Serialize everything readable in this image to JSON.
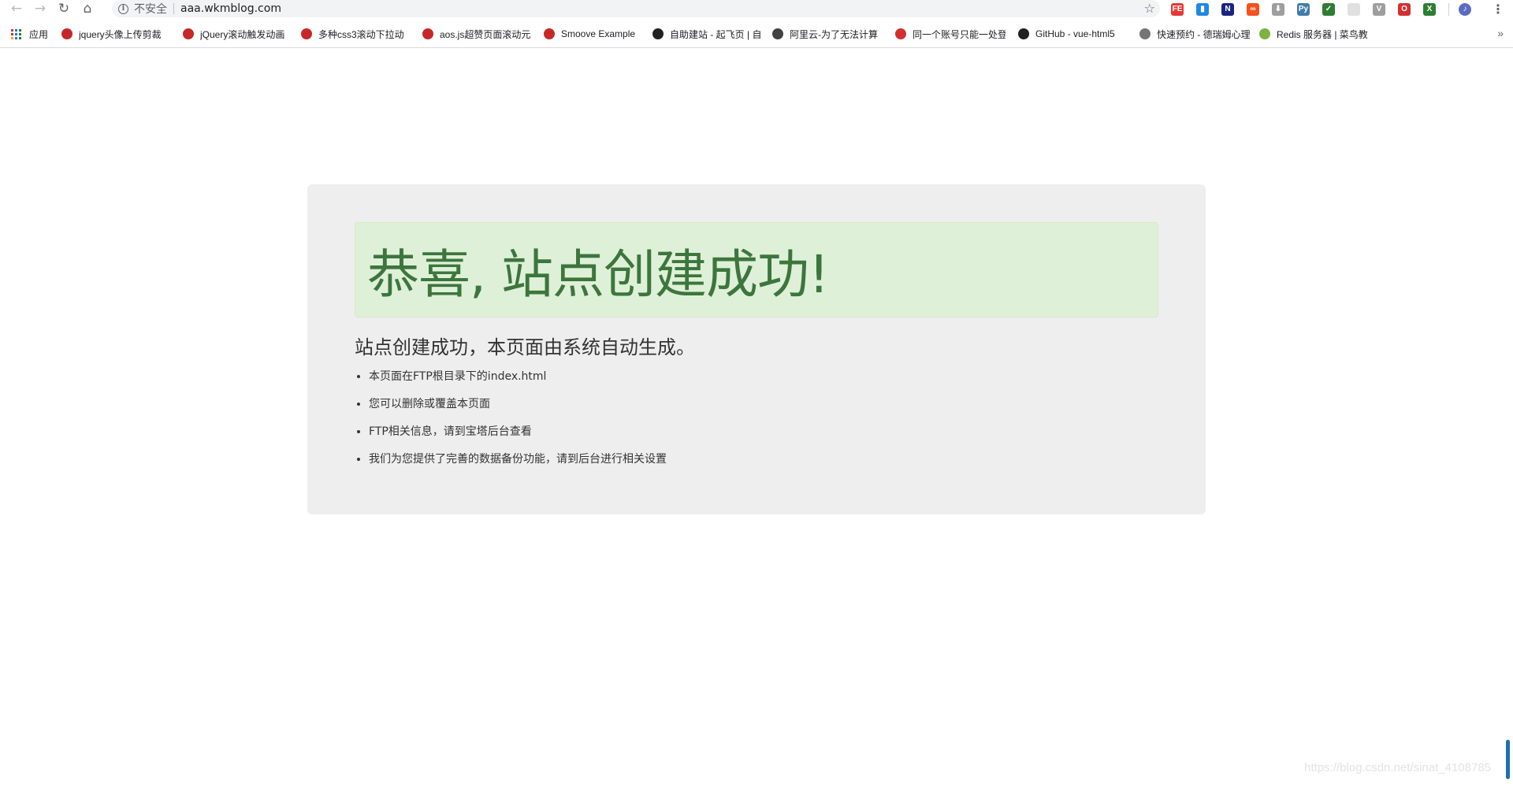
{
  "browser": {
    "nav": {
      "back_icon": "←",
      "forward_icon": "→",
      "reload_icon": "↻",
      "home_icon": "⌂"
    },
    "omnibox": {
      "info_icon": "i",
      "security_label": "不安全",
      "url": "aaa.wkmblog.com",
      "bookmark_star": "☆"
    },
    "extensions": [
      {
        "name": "fe-icon",
        "label": "FE",
        "color": "#e53935"
      },
      {
        "name": "trash-icon",
        "label": "▮",
        "color": "#1e88e5"
      },
      {
        "name": "notion-n-icon",
        "label": "N",
        "color": "#1a237e"
      },
      {
        "name": "infinity-icon",
        "label": "∞",
        "color": "#f4511e"
      },
      {
        "name": "download-icon",
        "label": "⬇",
        "color": "#9e9e9e"
      },
      {
        "name": "python-icon",
        "label": "Py",
        "color": "#3f7cac"
      },
      {
        "name": "shield-icon",
        "label": "✓",
        "color": "#2e7d32"
      },
      {
        "name": "blank-ext-icon",
        "label": "",
        "color": "#e0e0e0"
      },
      {
        "name": "vue-icon",
        "label": "V",
        "color": "#9e9e9e"
      },
      {
        "name": "opera-icon",
        "label": "O",
        "color": "#d32f2f"
      },
      {
        "name": "excel-icon",
        "label": "X",
        "color": "#2e7d32"
      }
    ],
    "profile_icon": "♪",
    "menu_icon": "⋮",
    "bookmarks_bar": {
      "apps_label": "应用",
      "items": [
        {
          "label": "jquery头像上传剪裁",
          "color": "#c62828"
        },
        {
          "label": "jQuery滚动触发动画",
          "color": "#c62828"
        },
        {
          "label": "多种css3滚动下拉动",
          "color": "#c62828"
        },
        {
          "label": "aos.js超赞页面滚动元",
          "color": "#c62828"
        },
        {
          "label": "Smoove Example",
          "color": "#c62828"
        },
        {
          "label": "自助建站 - 起飞页 | 自",
          "color": "#212121"
        },
        {
          "label": "阿里云-为了无法计算",
          "color": "#424242"
        },
        {
          "label": "同一个账号只能一处登",
          "color": "#d32f2f"
        },
        {
          "label": "GitHub - vue-html5",
          "color": "#212121"
        },
        {
          "label": "快速预约 - 德瑞姆心理",
          "color": "#757575"
        },
        {
          "label": "Redis 服务器 | 菜鸟教",
          "color": "#7cb342"
        }
      ],
      "more_icon": "»"
    }
  },
  "page": {
    "heading": "恭喜, 站点创建成功!",
    "lead": "站点创建成功，本页面由系统自动生成。",
    "items": [
      "本页面在FTP根目录下的index.html",
      "您可以删除或覆盖本页面",
      "FTP相关信息，请到宝塔后台查看",
      "我们为您提供了完善的数据备份功能，请到后台进行相关设置"
    ]
  },
  "watermark": "https://blog.csdn.net/sinat_4108785"
}
